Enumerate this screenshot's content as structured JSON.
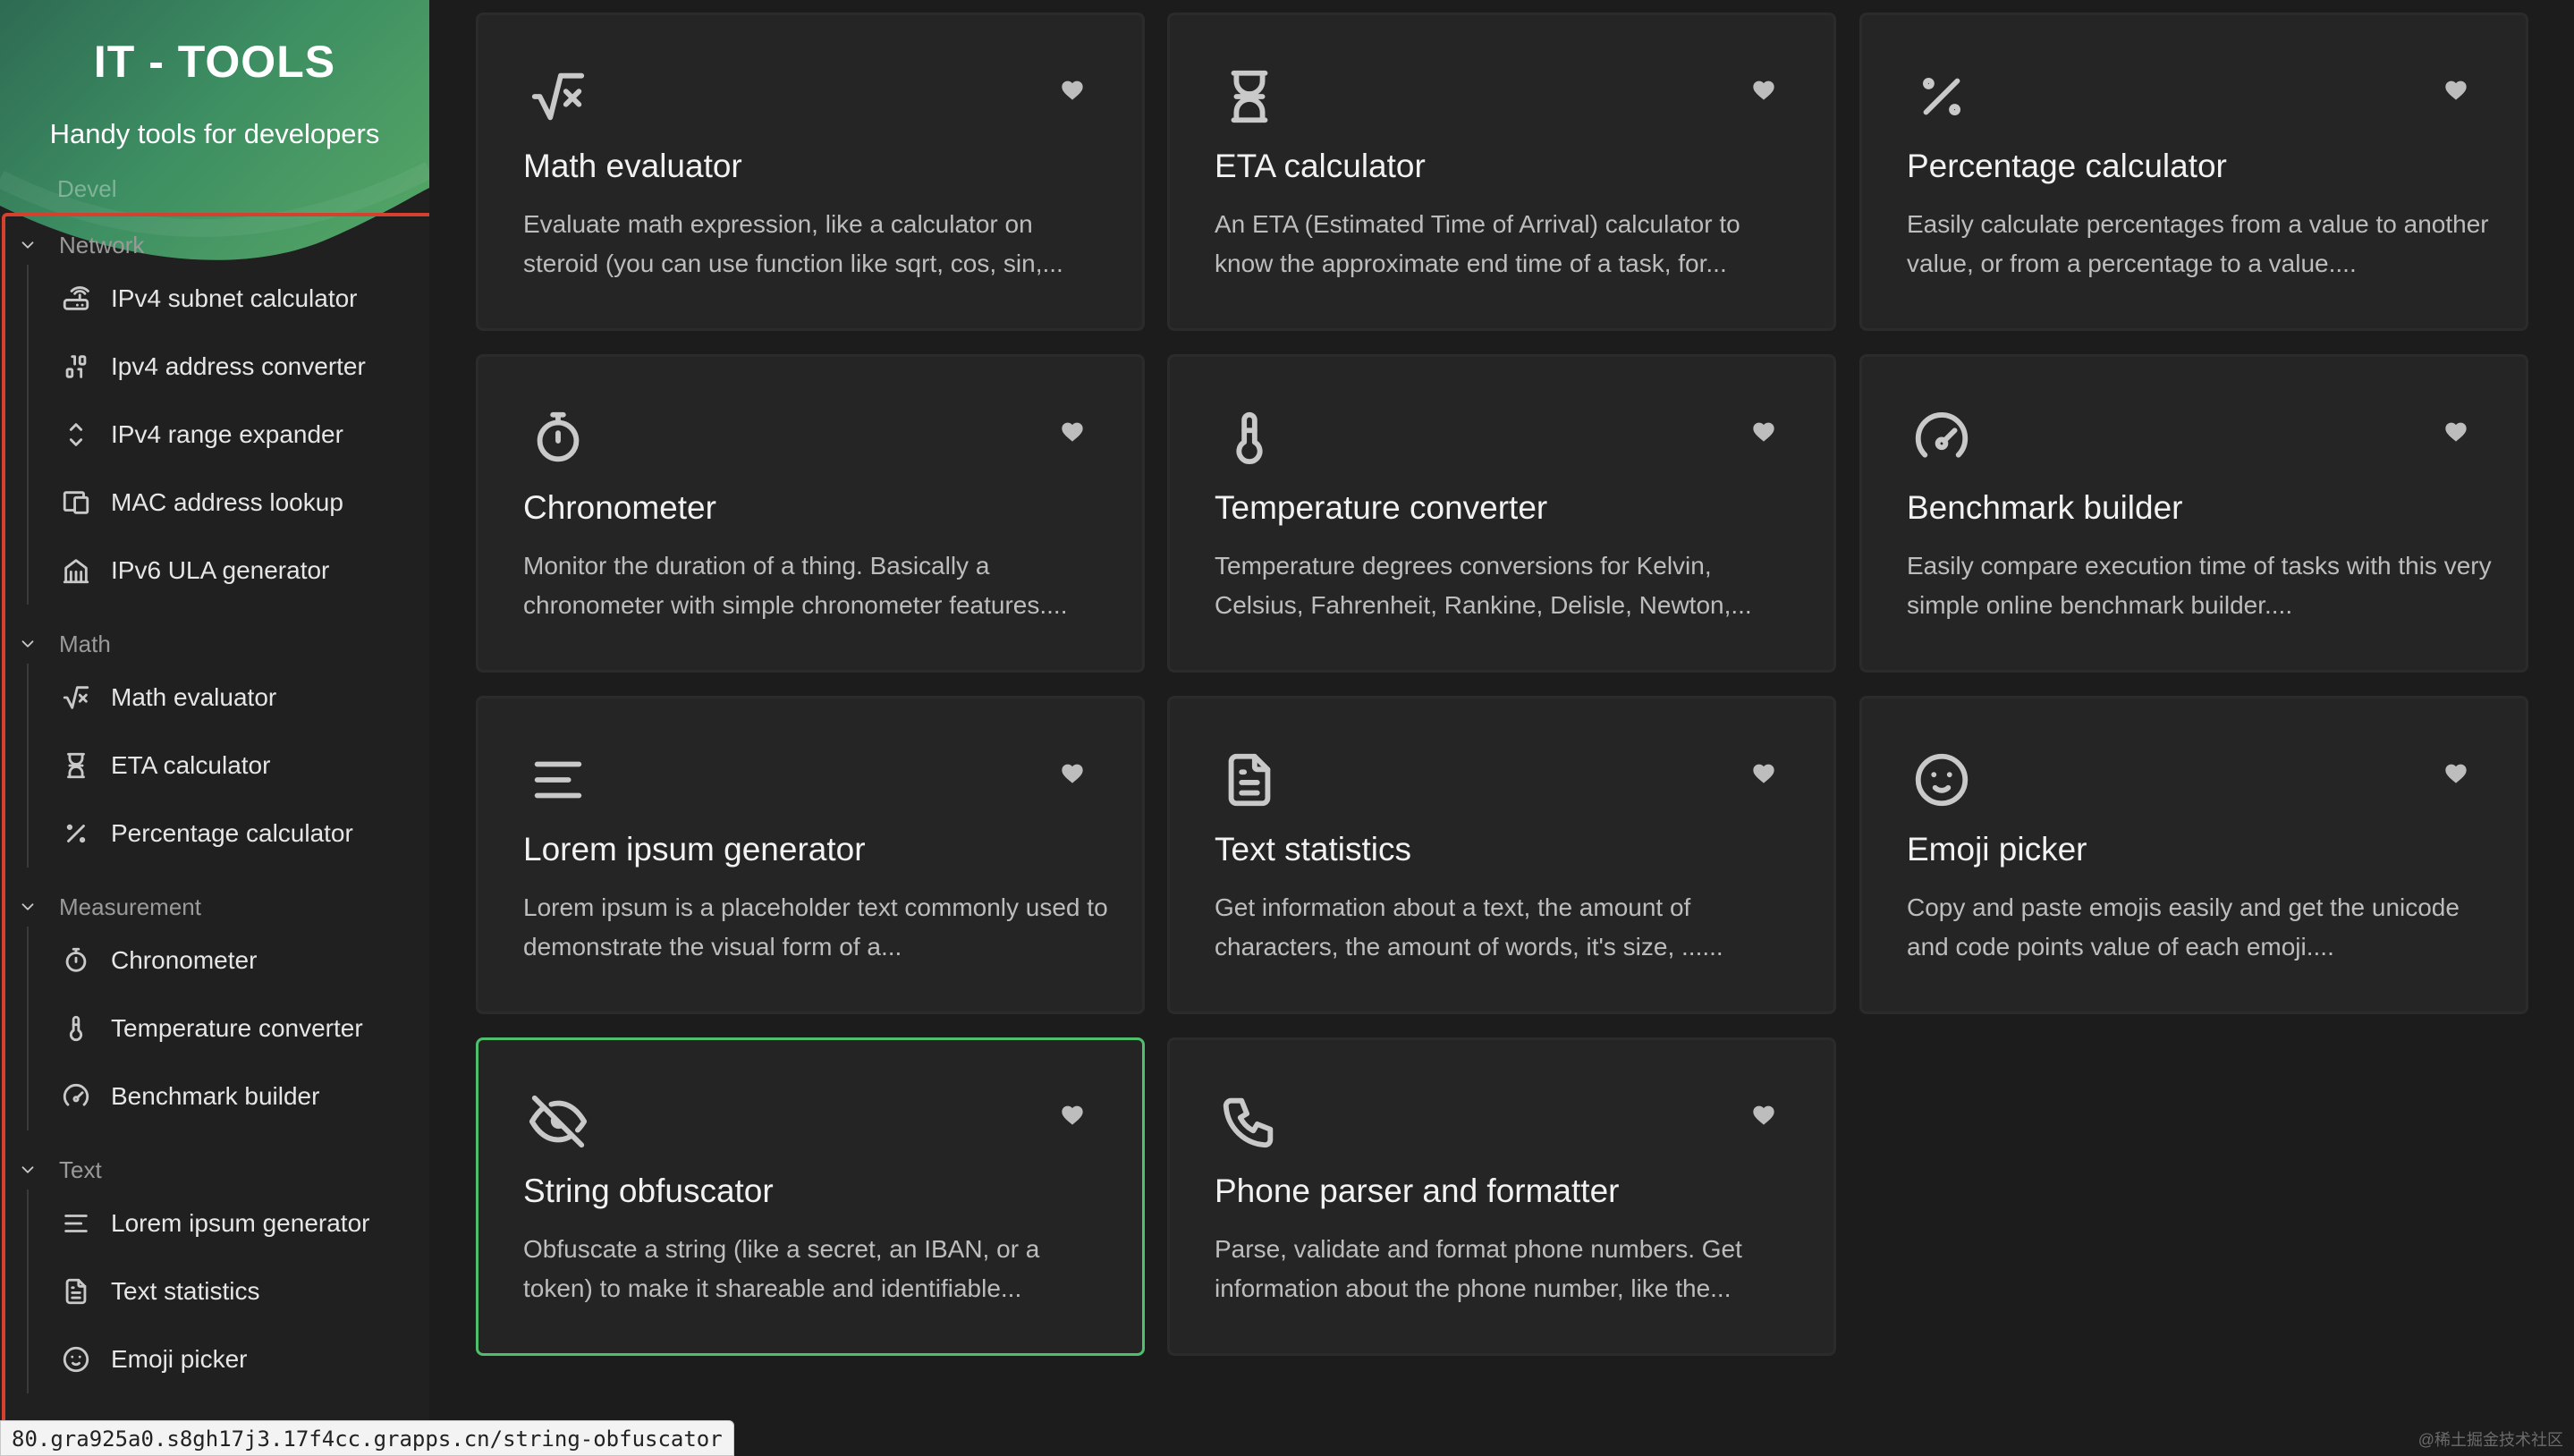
{
  "app": {
    "title": "IT - TOOLS",
    "subtitle": "Handy tools for developers",
    "faded_group": "Devel"
  },
  "sidebar": {
    "groups": [
      {
        "label": "Network",
        "items": [
          {
            "label": "IPv4 subnet calculator",
            "icon": "router-icon"
          },
          {
            "label": "Ipv4 address converter",
            "icon": "binary-icon"
          },
          {
            "label": "IPv4 range expander",
            "icon": "expand-vertical-icon"
          },
          {
            "label": "MAC address lookup",
            "icon": "devices-icon"
          },
          {
            "label": "IPv6 ULA generator",
            "icon": "building-icon"
          }
        ]
      },
      {
        "label": "Math",
        "items": [
          {
            "label": "Math evaluator",
            "icon": "square-root-icon"
          },
          {
            "label": "ETA calculator",
            "icon": "hourglass-icon"
          },
          {
            "label": "Percentage calculator",
            "icon": "percentage-icon"
          }
        ]
      },
      {
        "label": "Measurement",
        "items": [
          {
            "label": "Chronometer",
            "icon": "stopwatch-icon"
          },
          {
            "label": "Temperature converter",
            "icon": "thermometer-icon"
          },
          {
            "label": "Benchmark builder",
            "icon": "speedometer-icon"
          }
        ]
      },
      {
        "label": "Text",
        "items": [
          {
            "label": "Lorem ipsum generator",
            "icon": "text-align-icon"
          },
          {
            "label": "Text statistics",
            "icon": "file-text-icon"
          },
          {
            "label": "Emoji picker",
            "icon": "mood-smile-icon"
          }
        ]
      }
    ]
  },
  "cards": [
    {
      "title": "Math evaluator",
      "description": "Evaluate math expression, like a calculator on steroid (you can use function like sqrt, cos, sin,...",
      "icon": "square-root-icon"
    },
    {
      "title": "ETA calculator",
      "description": "An ETA (Estimated Time of Arrival) calculator to know the approximate end time of a task, for...",
      "icon": "hourglass-icon"
    },
    {
      "title": "Percentage calculator",
      "description": "Easily calculate percentages from a value to another value, or from a percentage to a value....",
      "icon": "percentage-icon"
    },
    {
      "title": "Chronometer",
      "description": "Monitor the duration of a thing. Basically a chronometer with simple chronometer features....",
      "icon": "stopwatch-icon"
    },
    {
      "title": "Temperature converter",
      "description": "Temperature degrees conversions for Kelvin, Celsius, Fahrenheit, Rankine, Delisle, Newton,...",
      "icon": "thermometer-icon"
    },
    {
      "title": "Benchmark builder",
      "description": "Easily compare execution time of tasks with this very simple online benchmark builder....",
      "icon": "speedometer-icon"
    },
    {
      "title": "Lorem ipsum generator",
      "description": "Lorem ipsum is a placeholder text commonly used to demonstrate the visual form of a...",
      "icon": "text-align-icon"
    },
    {
      "title": "Text statistics",
      "description": "Get information about a text, the amount of characters, the amount of words, it's size, ......",
      "icon": "file-text-icon"
    },
    {
      "title": "Emoji picker",
      "description": "Copy and paste emojis easily and get the unicode and code points value of each emoji....",
      "icon": "mood-smile-icon"
    },
    {
      "title": "String obfuscator",
      "description": "Obfuscate a string (like a secret, an IBAN, or a token) to make it shareable and identifiable...",
      "icon": "eye-off-icon",
      "active": true
    },
    {
      "title": "Phone parser and formatter",
      "description": "Parse, validate and format phone numbers. Get information about the phone number, like the...",
      "icon": "phone-icon"
    }
  ],
  "status_bar": {
    "url": "80.gra925a0.s8gh17j3.17f4cc.grapps.cn/string-obfuscator"
  },
  "watermark": "@稀土掘金技术社区",
  "colors": {
    "accent": "#4fbf6d",
    "highlight": "#d6412f",
    "background": "#1c1c1c",
    "card": "#252525"
  }
}
